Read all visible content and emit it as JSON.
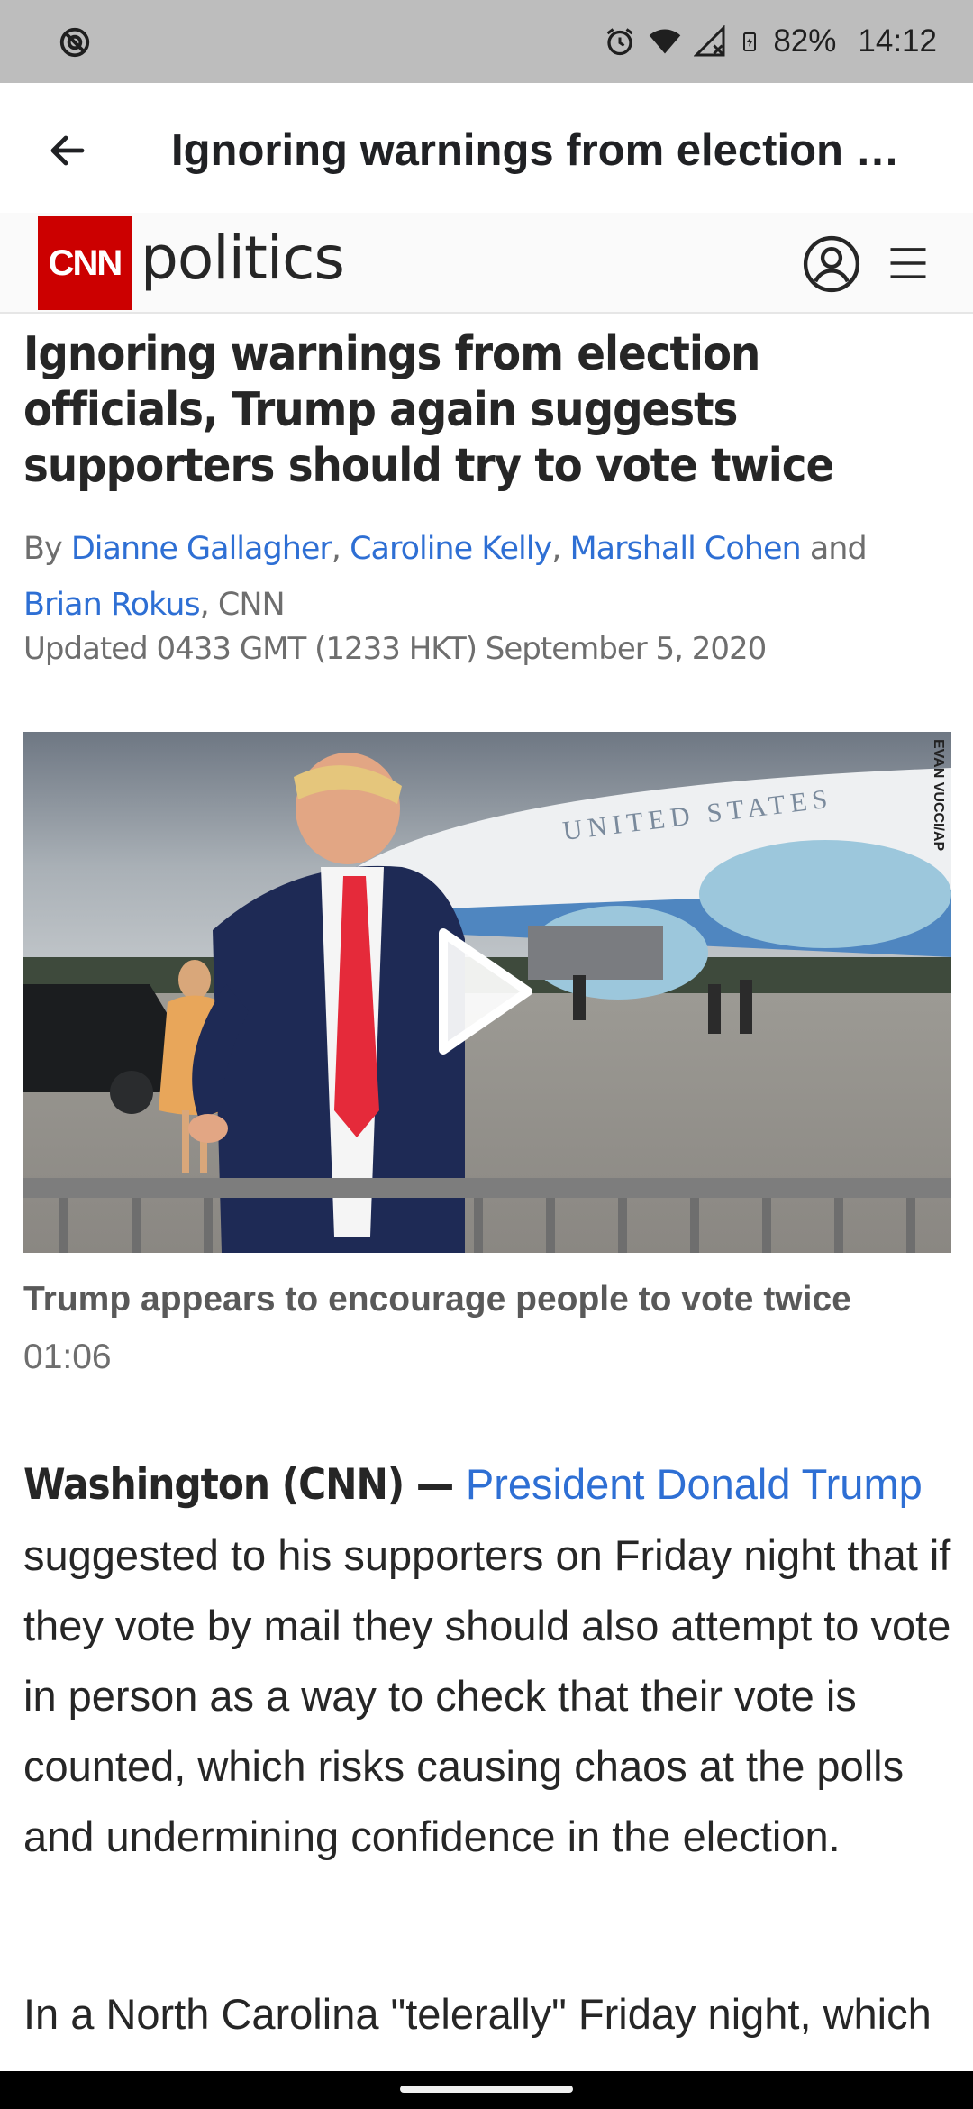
{
  "status_bar": {
    "battery": "82%",
    "time": "14:12"
  },
  "app_bar": {
    "title": "Ignoring warnings from election …"
  },
  "cnn_header": {
    "logo_text": "CNN",
    "section_name": "politics"
  },
  "article": {
    "headline": "Ignoring warnings from election officials, Trump again suggests supporters should try to vote twice",
    "byline": {
      "prefix": "By ",
      "authors": [
        "Dianne Gallagher",
        "Caroline Kelly",
        "Marshall Cohen",
        "Brian Rokus"
      ],
      "sep": ", ",
      "and": " and ",
      "suffix": ", CNN"
    },
    "updated": "Updated 0433 GMT (1233 HKT) September 5, 2020",
    "video": {
      "photo_credit": "EVAN VUCCI/AP",
      "plane_text": "UNITED STATES",
      "caption": "Trump appears to encourage people to vote twice",
      "duration": "01:06"
    },
    "paragraph1": {
      "dateline": "Washington (CNN) — ",
      "link": "President Donald Trump",
      "text": " suggested to his supporters on Friday night that if they vote by mail they should also attempt to vote in person as a way to check that their vote is counted, which risks causing chaos at the polls and undermining confidence in the election."
    },
    "paragraph2": {
      "text": "In a North Carolina \"telerally\" Friday night, which"
    }
  },
  "colors": {
    "cnn_red": "#cc0000",
    "link_blue": "#2e6fd4",
    "status_bar_bg": "#bdbdbd"
  }
}
